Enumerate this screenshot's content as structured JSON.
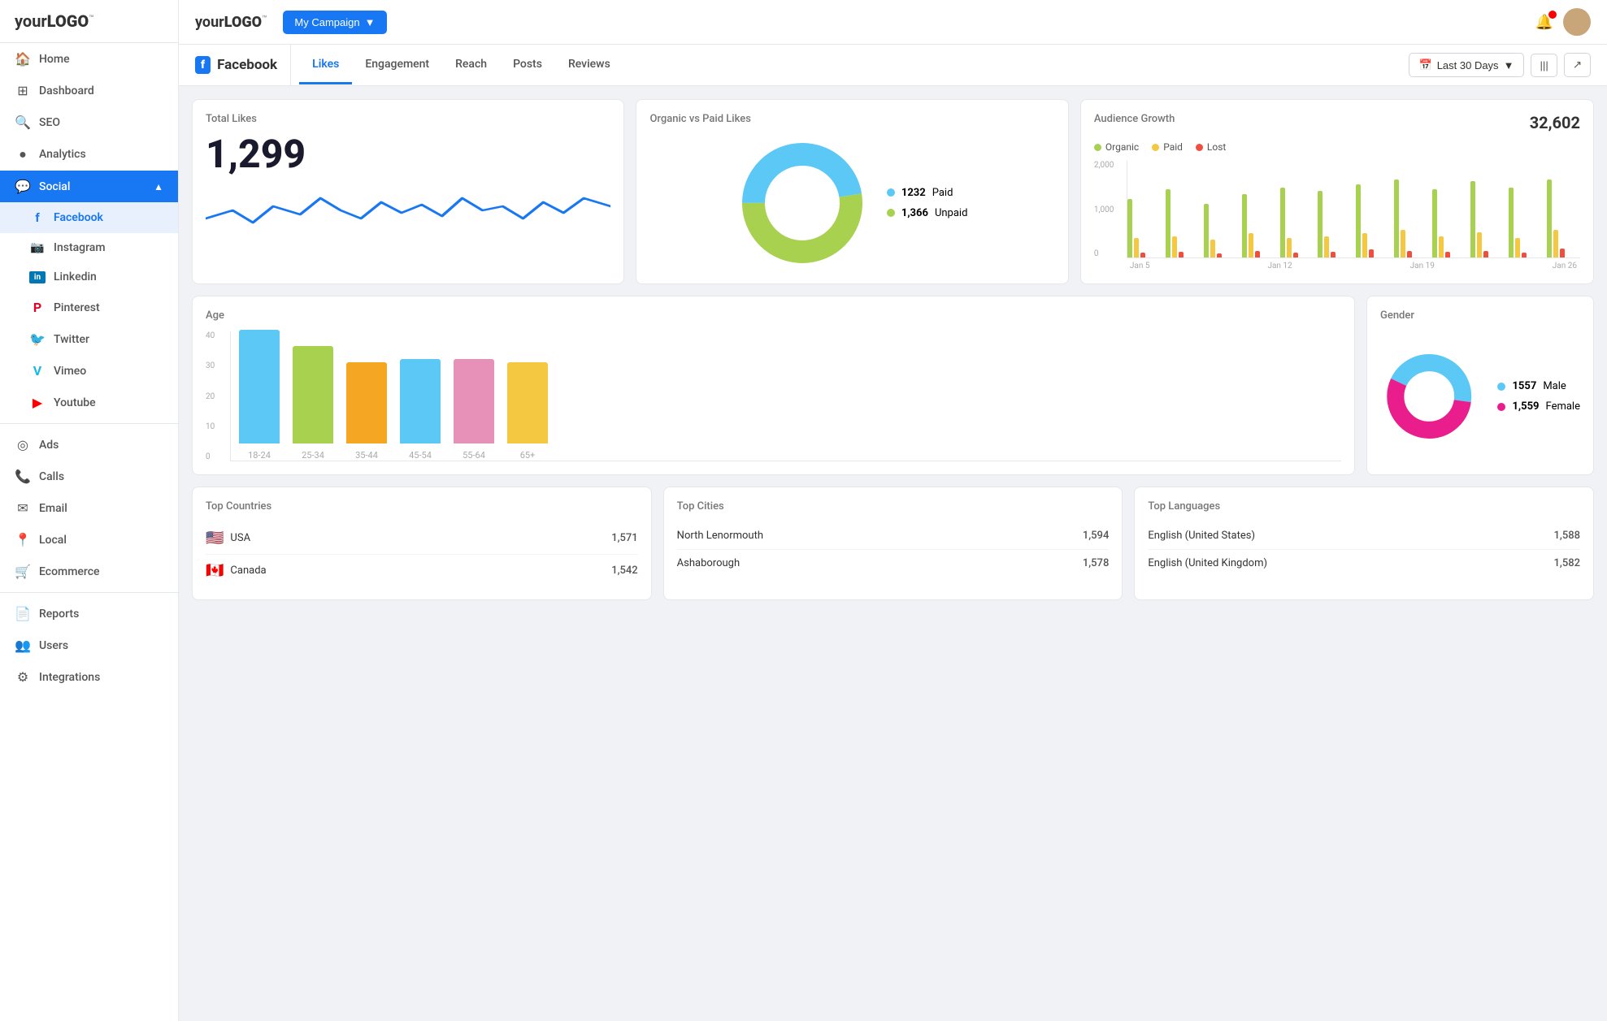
{
  "sidebar": {
    "logo": "yourLOGO",
    "campaign_btn": "My Campaign",
    "items": [
      {
        "id": "home",
        "label": "Home",
        "icon": "🏠"
      },
      {
        "id": "dashboard",
        "label": "Dashboard",
        "icon": "⊞"
      },
      {
        "id": "seo",
        "label": "SEO",
        "icon": "🔍"
      },
      {
        "id": "analytics",
        "label": "Analytics",
        "icon": "📊"
      },
      {
        "id": "social",
        "label": "Social",
        "icon": "💬",
        "active": true,
        "expandable": true
      },
      {
        "id": "facebook",
        "label": "Facebook",
        "icon": "f",
        "sub": true
      },
      {
        "id": "instagram",
        "label": "Instagram",
        "icon": "📷",
        "sub": true
      },
      {
        "id": "linkedin",
        "label": "Linkedin",
        "icon": "in",
        "sub": true
      },
      {
        "id": "pinterest",
        "label": "Pinterest",
        "icon": "P",
        "sub": true
      },
      {
        "id": "twitter",
        "label": "Twitter",
        "icon": "🐦",
        "sub": true
      },
      {
        "id": "vimeo",
        "label": "Vimeo",
        "icon": "V",
        "sub": true
      },
      {
        "id": "youtube",
        "label": "Youtube",
        "icon": "▶",
        "sub": true
      },
      {
        "id": "ads",
        "label": "Ads",
        "icon": "◎"
      },
      {
        "id": "calls",
        "label": "Calls",
        "icon": "📞"
      },
      {
        "id": "email",
        "label": "Email",
        "icon": "✉"
      },
      {
        "id": "local",
        "label": "Local",
        "icon": "📍"
      },
      {
        "id": "ecommerce",
        "label": "Ecommerce",
        "icon": "🛒"
      },
      {
        "id": "reports",
        "label": "Reports",
        "icon": "📄"
      },
      {
        "id": "users",
        "label": "Users",
        "icon": "👥"
      },
      {
        "id": "integrations",
        "label": "Integrations",
        "icon": "⚙"
      }
    ]
  },
  "topnav": {
    "logo": "yourLOGO",
    "campaign": "My Campaign"
  },
  "page_header": {
    "brand": "Facebook",
    "tabs": [
      "Likes",
      "Engagement",
      "Reach",
      "Posts",
      "Reviews"
    ],
    "active_tab": "Likes",
    "date_filter": "Last 30 Days"
  },
  "total_likes": {
    "title": "Total Likes",
    "value": "1,299"
  },
  "organic_paid": {
    "title": "Organic vs Paid Likes",
    "paid_count": "1232",
    "paid_label": "Paid",
    "unpaid_count": "1,366",
    "unpaid_label": "Unpaid"
  },
  "audience_growth": {
    "title": "Audience Growth",
    "total": "32,602",
    "legend": [
      {
        "label": "Organic",
        "color": "#a8d150"
      },
      {
        "label": "Paid",
        "color": "#f5c842"
      },
      {
        "label": "Lost",
        "color": "#f04e3e"
      }
    ],
    "x_labels": [
      "Jan 5",
      "Jan 12",
      "Jan 19",
      "Jan 26"
    ],
    "y_labels": [
      "2,000",
      "1,000",
      "0"
    ],
    "bars": [
      {
        "organic": 60,
        "paid": 20,
        "lost": 5
      },
      {
        "organic": 70,
        "paid": 22,
        "lost": 6
      },
      {
        "organic": 55,
        "paid": 18,
        "lost": 4
      },
      {
        "organic": 65,
        "paid": 25,
        "lost": 7
      },
      {
        "organic": 72,
        "paid": 20,
        "lost": 5
      },
      {
        "organic": 68,
        "paid": 22,
        "lost": 6
      },
      {
        "organic": 75,
        "paid": 25,
        "lost": 8
      },
      {
        "organic": 80,
        "paid": 28,
        "lost": 7
      },
      {
        "organic": 70,
        "paid": 22,
        "lost": 6
      },
      {
        "organic": 78,
        "paid": 26,
        "lost": 7
      },
      {
        "organic": 72,
        "paid": 20,
        "lost": 5
      },
      {
        "organic": 80,
        "paid": 28,
        "lost": 9
      }
    ]
  },
  "age": {
    "title": "Age",
    "y_labels": [
      "40",
      "30",
      "20",
      "10",
      "0"
    ],
    "bars": [
      {
        "label": "18-24",
        "value": 35,
        "color": "#5bc8f5"
      },
      {
        "label": "25-34",
        "value": 30,
        "color": "#a8d150"
      },
      {
        "label": "35-44",
        "value": 25,
        "color": "#f5a623"
      },
      {
        "label": "45-54",
        "value": 26,
        "color": "#5bc8f5"
      },
      {
        "label": "55-64",
        "value": 26,
        "color": "#e891b8"
      },
      {
        "label": "65+",
        "value": 25,
        "color": "#f5c842"
      }
    ]
  },
  "gender": {
    "title": "Gender",
    "male_count": "1557",
    "male_label": "Male",
    "female_count": "1,559",
    "female_label": "Female",
    "male_color": "#5bc8f5",
    "female_color": "#e91e8c"
  },
  "top_countries": {
    "title": "Top Countries",
    "items": [
      {
        "flag": "🇺🇸",
        "name": "USA",
        "value": "1,571"
      },
      {
        "flag": "🇨🇦",
        "name": "Canada",
        "value": "1,542"
      }
    ]
  },
  "top_cities": {
    "title": "Top Cities",
    "items": [
      {
        "name": "North Lenormouth",
        "value": "1,594"
      },
      {
        "name": "Ashaborough",
        "value": "1,578"
      }
    ]
  },
  "top_languages": {
    "title": "Top Languages",
    "items": [
      {
        "name": "English (United States)",
        "value": "1,588"
      },
      {
        "name": "English (United Kingdom)",
        "value": "1,582"
      }
    ]
  }
}
